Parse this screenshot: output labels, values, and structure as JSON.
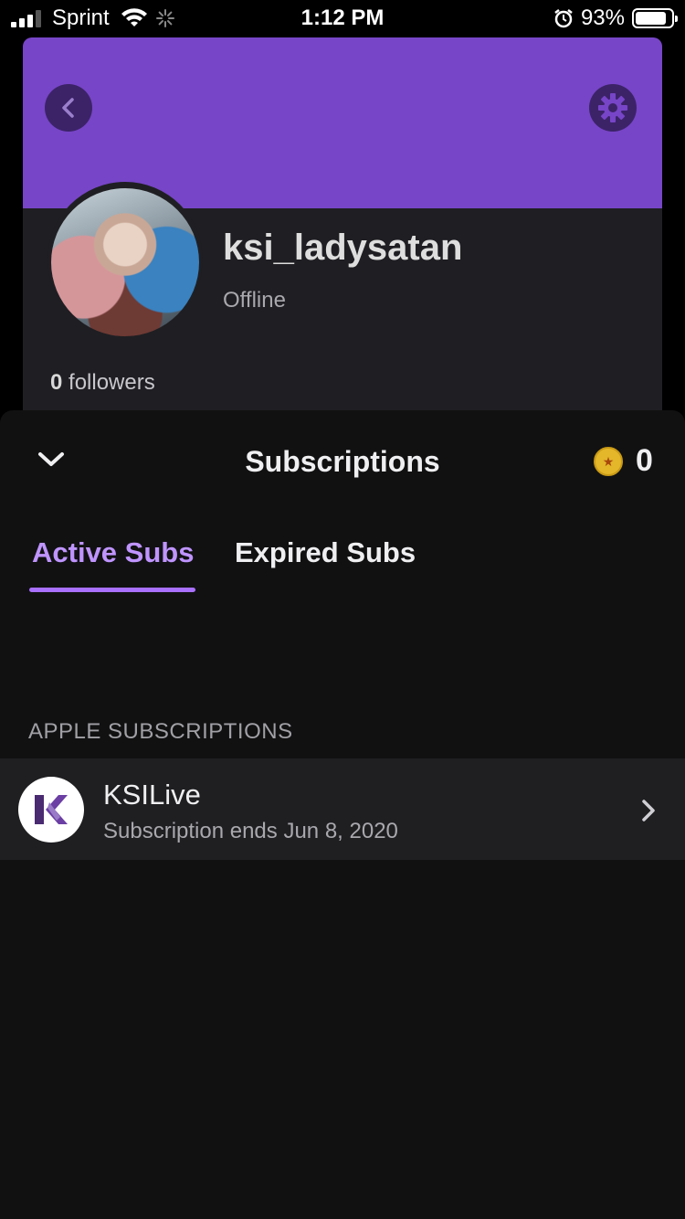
{
  "status_bar": {
    "carrier": "Sprint",
    "time": "1:12 PM",
    "battery_percent": "93%",
    "battery_level": 0.93
  },
  "profile": {
    "username": "ksi_ladysatan",
    "status": "Offline",
    "followers_count": "0",
    "followers_label": "followers",
    "banner_color": "#7745c7"
  },
  "sheet": {
    "title": "Subscriptions",
    "coin_count": "0",
    "tabs": [
      {
        "label": "Active Subs",
        "active": true
      },
      {
        "label": "Expired Subs",
        "active": false
      }
    ],
    "section_label": "APPLE SUBSCRIPTIONS",
    "subscriptions": [
      {
        "name": "KSILive",
        "detail": "Subscription ends Jun 8, 2020"
      }
    ]
  },
  "colors": {
    "accent": "#a970ff",
    "accent_text": "#bf94ff",
    "background": "#111112"
  }
}
